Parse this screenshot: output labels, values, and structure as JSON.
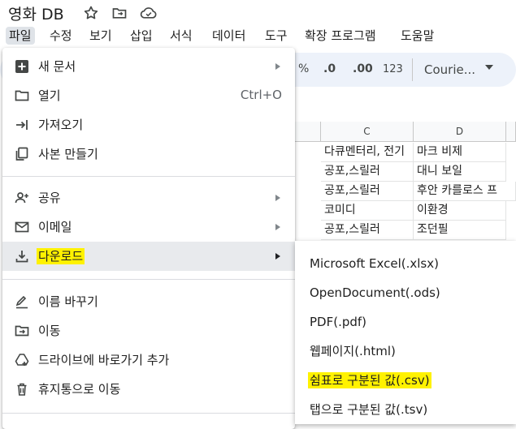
{
  "title": {
    "doc_name": "영화 DB",
    "icons": [
      "star-icon",
      "move-folder-icon",
      "cloud-status-icon"
    ]
  },
  "menubar": {
    "items": [
      "파일",
      "수정",
      "보기",
      "삽입",
      "서식",
      "데이터",
      "도구",
      "확장 프로그램",
      "도움말"
    ],
    "active": "파일"
  },
  "toolbar": {
    "percent": "%",
    "decrease_decimal": ".0",
    "increase_decimal": ".00",
    "number_format": "123",
    "font": "Courie..."
  },
  "grid": {
    "columns": [
      "C",
      "D"
    ],
    "rows": [
      [
        "다큐멘터리, 전기",
        "마크 비제"
      ],
      [
        "공포,스릴러",
        "대니 보일"
      ],
      [
        "공포,스릴러",
        "후안 카를로스 프"
      ],
      [
        "코미디",
        "이환경"
      ],
      [
        "공포,스릴러",
        "조던필"
      ]
    ]
  },
  "file_menu": {
    "items": [
      {
        "label": "새 문서",
        "icon": "new-sheet-icon",
        "submenu": true
      },
      {
        "label": "열기",
        "icon": "open-folder-icon",
        "shortcut": "Ctrl+O"
      },
      {
        "label": "가져오기",
        "icon": "import-icon"
      },
      {
        "label": "사본 만들기",
        "icon": "copy-icon"
      },
      {
        "label": "공유",
        "icon": "share-person-icon",
        "submenu": true
      },
      {
        "label": "이메일",
        "icon": "email-icon",
        "submenu": true
      },
      {
        "label": "다운로드",
        "icon": "download-icon",
        "submenu": true,
        "highlighted": true
      },
      {
        "label": "이름 바꾸기",
        "icon": "rename-icon"
      },
      {
        "label": "이동",
        "icon": "move-icon"
      },
      {
        "label": "드라이브에 바로가기 추가",
        "icon": "drive-shortcut-icon"
      },
      {
        "label": "휴지통으로 이동",
        "icon": "trash-icon"
      }
    ]
  },
  "download_submenu": {
    "items": [
      {
        "label": "Microsoft Excel(.xlsx)"
      },
      {
        "label": "OpenDocument(.ods)"
      },
      {
        "label": "PDF(.pdf)"
      },
      {
        "label": "웹페이지(.html)"
      },
      {
        "label": "쉼표로 구분된 값(.csv)",
        "highlighted": true
      },
      {
        "label": "탭으로 구분된 값(.tsv)"
      }
    ]
  },
  "colors": {
    "highlight": "#fff200",
    "hover": "#e8eaed",
    "toolbar_bg": "#edf2fa"
  }
}
